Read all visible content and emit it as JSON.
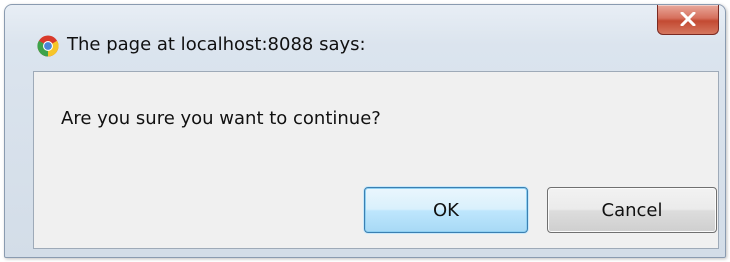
{
  "dialog": {
    "title": "The page at localhost:8088 says:",
    "message": "Are you sure you want to continue?",
    "ok_label": "OK",
    "cancel_label": "Cancel",
    "title_icon": "chrome-icon",
    "close_icon": "close-icon"
  }
}
